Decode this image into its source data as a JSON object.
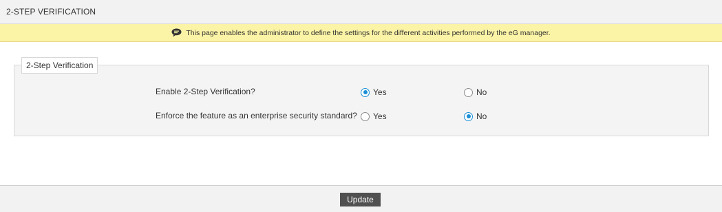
{
  "header": {
    "title": "2-STEP VERIFICATION"
  },
  "info_bar": {
    "icon": "speech-bubble-icon",
    "text": "This page enables the administrator to define the settings for the different activities performed by the eG manager.",
    "background": "#fbf3a6"
  },
  "section": {
    "legend": "2-Step Verification",
    "rows": [
      {
        "label": "Enable 2-Step Verification?",
        "options": [
          {
            "label": "Yes",
            "checked": true
          },
          {
            "label": "No",
            "checked": false
          }
        ]
      },
      {
        "label": "Enforce the feature as an enterprise security standard?",
        "options": [
          {
            "label": "Yes",
            "checked": false
          },
          {
            "label": "No",
            "checked": true
          }
        ]
      }
    ]
  },
  "footer": {
    "update_label": "Update"
  },
  "colors": {
    "accent": "#1a8fd6",
    "button": "#505050"
  }
}
